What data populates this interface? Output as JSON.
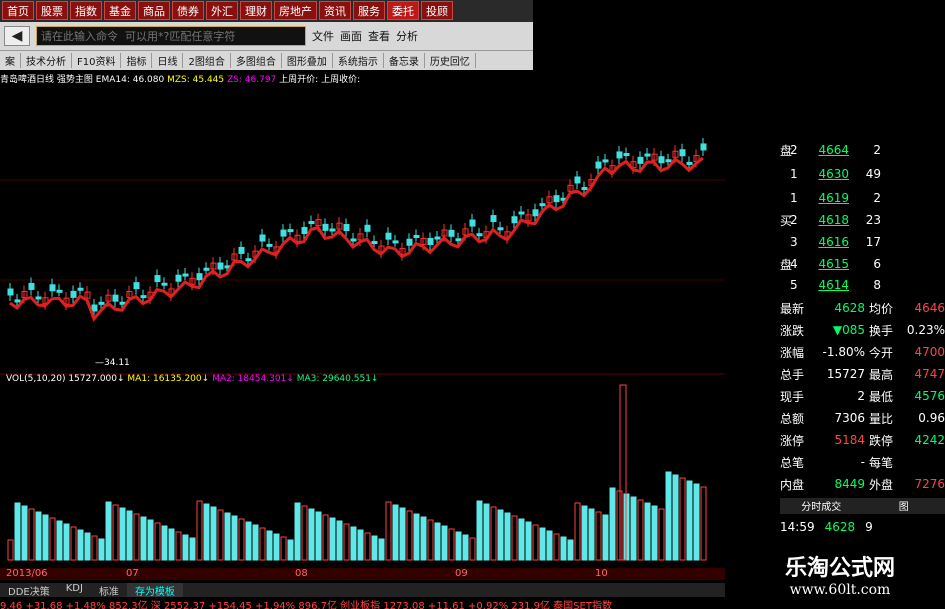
{
  "nav": [
    "首页",
    "股票",
    "指数",
    "基金",
    "商品",
    "债券",
    "外汇",
    "理财",
    "房地产",
    "资讯",
    "服务",
    "委托",
    "投顾"
  ],
  "toolbar": {
    "back_label": "◀",
    "command_placeholder": "请在此输入命令  可以用*?匹配任意字符",
    "menu": [
      "文件",
      "画面",
      "查看",
      "分析"
    ]
  },
  "tools": [
    "案",
    "技术分析",
    "F10资料",
    "指标",
    "日线",
    "2图组合",
    "多图组合",
    "图形叠加",
    "系统指示",
    "备忘录",
    "历史回忆"
  ],
  "price_header": {
    "stock": "青岛啤酒日线",
    "main": "强势主图",
    "ema": "EMA14: 46.080",
    "mzs": "MZS: 45.445",
    "zs": "ZS: 46.797",
    "open": "上周开价:",
    "close": "上周收价:"
  },
  "vol_header": {
    "vol": "VOL(5,10,20) 15727.000↓",
    "ma1": "MA1: 16135.200↓",
    "ma2": "MA2: 18454.301↓",
    "ma3": "MA3: 29640.551↓"
  },
  "low_mark": "34.11",
  "dates": [
    "2013/06",
    "07",
    "08",
    "09",
    "10"
  ],
  "bottom_tabs": [
    "DDE决策",
    "KDJ",
    "标准",
    "存为模板"
  ],
  "ticker": "9.46 +31.68 +1.48% 852.3亿 深 2552.37 +154.45 +1.94% 896.7亿 创业板指 1273.08 +11.61 +0.92% 231.9亿 泰国SET指数",
  "orders": [
    {
      "side": "盘",
      "lvl": "2",
      "price": "4664",
      "vol": "2"
    },
    {
      "side": "",
      "lvl": "1",
      "price": "4630",
      "vol": "49"
    },
    {
      "side": "",
      "lvl": "1",
      "price": "4619",
      "vol": "2"
    },
    {
      "side": "买",
      "lvl": "2",
      "price": "4618",
      "vol": "23"
    },
    {
      "side": "",
      "lvl": "3",
      "price": "4616",
      "vol": "17"
    },
    {
      "side": "盘",
      "lvl": "4",
      "price": "4615",
      "vol": "6"
    },
    {
      "side": "",
      "lvl": "5",
      "price": "4614",
      "vol": "8"
    }
  ],
  "stats": [
    {
      "k": "最新",
      "v": "4628",
      "k2": "均价",
      "v2": "4646",
      "c": "g",
      "c2": "r"
    },
    {
      "k": "涨跌",
      "v": "▼085",
      "k2": "换手",
      "v2": "0.23%",
      "c": "g",
      "c2": "w"
    },
    {
      "k": "涨幅",
      "v": "-1.80%",
      "k2": "今开",
      "v2": "4700",
      "c": "w",
      "c2": "r"
    },
    {
      "k": "总手",
      "v": "15727",
      "k2": "最高",
      "v2": "4747",
      "c": "w",
      "c2": "r"
    },
    {
      "k": "现手",
      "v": "2",
      "k2": "最低",
      "v2": "4576",
      "c": "w",
      "c2": "g"
    },
    {
      "k": "总额",
      "v": "7306",
      "k2": "量比",
      "v2": "0.96",
      "c": "w",
      "c2": "w"
    },
    {
      "k": "涨停",
      "v": "5184",
      "k2": "跌停",
      "v2": "4242",
      "c": "r",
      "c2": "g"
    },
    {
      "k": "总笔",
      "v": "-",
      "k2": "每笔",
      "v2": "",
      "c": "w",
      "c2": "w"
    },
    {
      "k": "内盘",
      "v": "8449",
      "k2": "外盘",
      "v2": "7276",
      "c": "g",
      "c2": "r"
    }
  ],
  "trade": {
    "title": "分时成交",
    "title2": "图",
    "time": "14:59",
    "price": "4628",
    "vol": "9"
  },
  "watermark": {
    "title": "乐淘公式网",
    "url": "www.60lt.com"
  },
  "colors": {
    "up": "#ff3030",
    "down": "#40e0e0",
    "ema_up": "#e02020",
    "ema_down": "#30e030",
    "vol_up": "#ff4040",
    "vol_down": "#60e8e8"
  }
}
